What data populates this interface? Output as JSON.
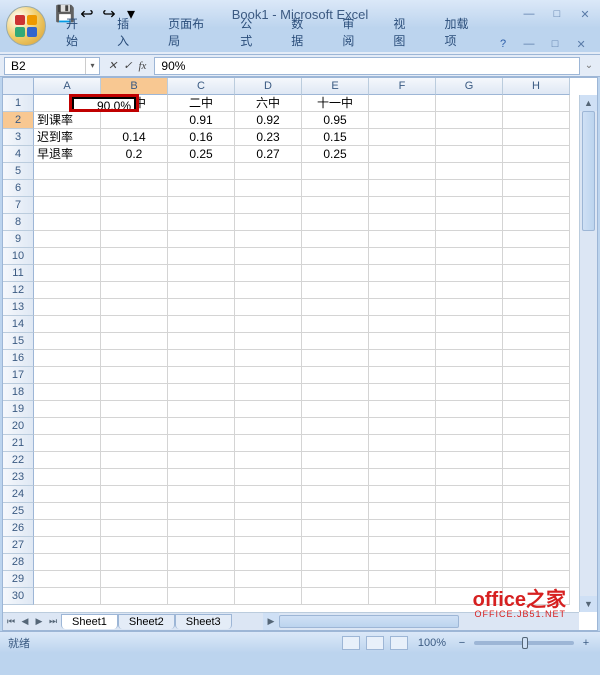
{
  "window": {
    "title": "Book1 - Microsoft Excel"
  },
  "ribbon": {
    "tabs": [
      "开始",
      "插入",
      "页面布局",
      "公式",
      "数据",
      "审阅",
      "视图",
      "加载项"
    ],
    "active_tab_index": null
  },
  "namebox": {
    "value": "B2"
  },
  "formula_bar": {
    "value": "90%"
  },
  "columns": [
    "A",
    "B",
    "C",
    "D",
    "E",
    "F",
    "G",
    "H"
  ],
  "row_count": 30,
  "selected": {
    "col": "B",
    "row": 2,
    "display": "90.0%"
  },
  "cells": {
    "headers_row1": {
      "B": "一中",
      "C": "二中",
      "D": "六中",
      "E": "十一中"
    },
    "data": [
      {
        "label": "到课率",
        "B": "90.0%",
        "C": "0.91",
        "D": "0.92",
        "E": "0.95"
      },
      {
        "label": "迟到率",
        "B": "0.14",
        "C": "0.16",
        "D": "0.23",
        "E": "0.15"
      },
      {
        "label": "早退率",
        "B": "0.2",
        "C": "0.25",
        "D": "0.27",
        "E": "0.25"
      }
    ]
  },
  "sheet_tabs": [
    "Sheet1",
    "Sheet2",
    "Sheet3"
  ],
  "active_sheet_index": 0,
  "statusbar": {
    "ready": "就绪",
    "zoom": "100%"
  },
  "watermark": {
    "main": "office之家",
    "sub": "OFFICE.JB51.NET"
  },
  "icons": {
    "save": "💾",
    "undo": "↩",
    "redo": "↪",
    "min": "—",
    "max": "□",
    "close": "✕",
    "help": "?",
    "chev": "▾"
  },
  "chart_data": {
    "type": "table",
    "title": "",
    "columns": [
      "",
      "一中",
      "二中",
      "六中",
      "十一中"
    ],
    "rows": [
      [
        "到课率",
        0.9,
        0.91,
        0.92,
        0.95
      ],
      [
        "迟到率",
        0.14,
        0.16,
        0.23,
        0.15
      ],
      [
        "早退率",
        0.2,
        0.25,
        0.27,
        0.25
      ]
    ]
  }
}
